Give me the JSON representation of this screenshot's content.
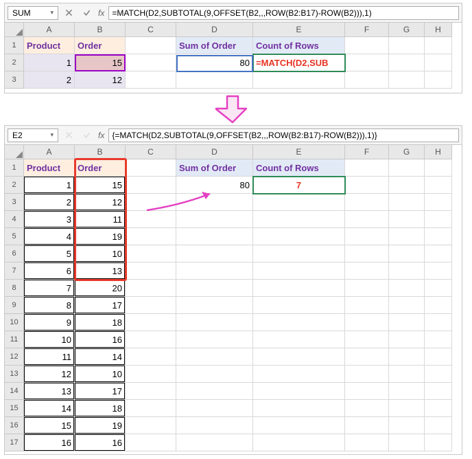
{
  "top": {
    "name_box": "SUM",
    "formula": "=MATCH(D2,SUBTOTAL(9,OFFSET(B2,,,ROW(B2:B17)-ROW(B2))),1)",
    "cols": [
      "A",
      "B",
      "C",
      "D",
      "E",
      "F",
      "G",
      "H"
    ],
    "rows": [
      "1",
      "2",
      "3"
    ],
    "A1": "Product",
    "B1": "Order",
    "D1": "Sum of Order",
    "E1": "Count of Rows",
    "A2": "1",
    "B2": "15",
    "D2": "80",
    "E2": "=MATCH(D2,SUB",
    "A3": "2",
    "B3": "12"
  },
  "bottom": {
    "name_box": "E2",
    "formula": "{=MATCH(D2,SUBTOTAL(9,OFFSET(B2,,,ROW(B2:B17)-ROW(B2))),1)}",
    "cols": [
      "A",
      "B",
      "C",
      "D",
      "E",
      "F",
      "G",
      "H"
    ],
    "rows": [
      "1",
      "2",
      "3",
      "4",
      "5",
      "6",
      "7",
      "8",
      "9",
      "10",
      "11",
      "12",
      "13",
      "14",
      "15",
      "16",
      "17"
    ],
    "D1": "Sum of Order",
    "E1": "Count of Rows",
    "D2": "80",
    "E2": "7",
    "header_product": "Product",
    "header_order": "Order",
    "products": [
      "1",
      "2",
      "3",
      "4",
      "5",
      "6",
      "7",
      "8",
      "9",
      "10",
      "11",
      "12",
      "13",
      "14",
      "15",
      "16"
    ],
    "orders": [
      "15",
      "12",
      "11",
      "19",
      "10",
      "13",
      "20",
      "17",
      "18",
      "16",
      "14",
      "10",
      "17",
      "18",
      "19",
      "16"
    ]
  },
  "chart_data": {
    "type": "table",
    "title": "Excel worksheet showing MATCH+SUBTOTAL formula",
    "categories": [
      "1",
      "2",
      "3",
      "4",
      "5",
      "6",
      "7",
      "8",
      "9",
      "10",
      "11",
      "12",
      "13",
      "14",
      "15",
      "16"
    ],
    "values": [
      15,
      12,
      11,
      19,
      10,
      13,
      20,
      17,
      18,
      16,
      14,
      10,
      17,
      18,
      19,
      16
    ],
    "xlabel": "Product",
    "ylabel": "Order"
  }
}
